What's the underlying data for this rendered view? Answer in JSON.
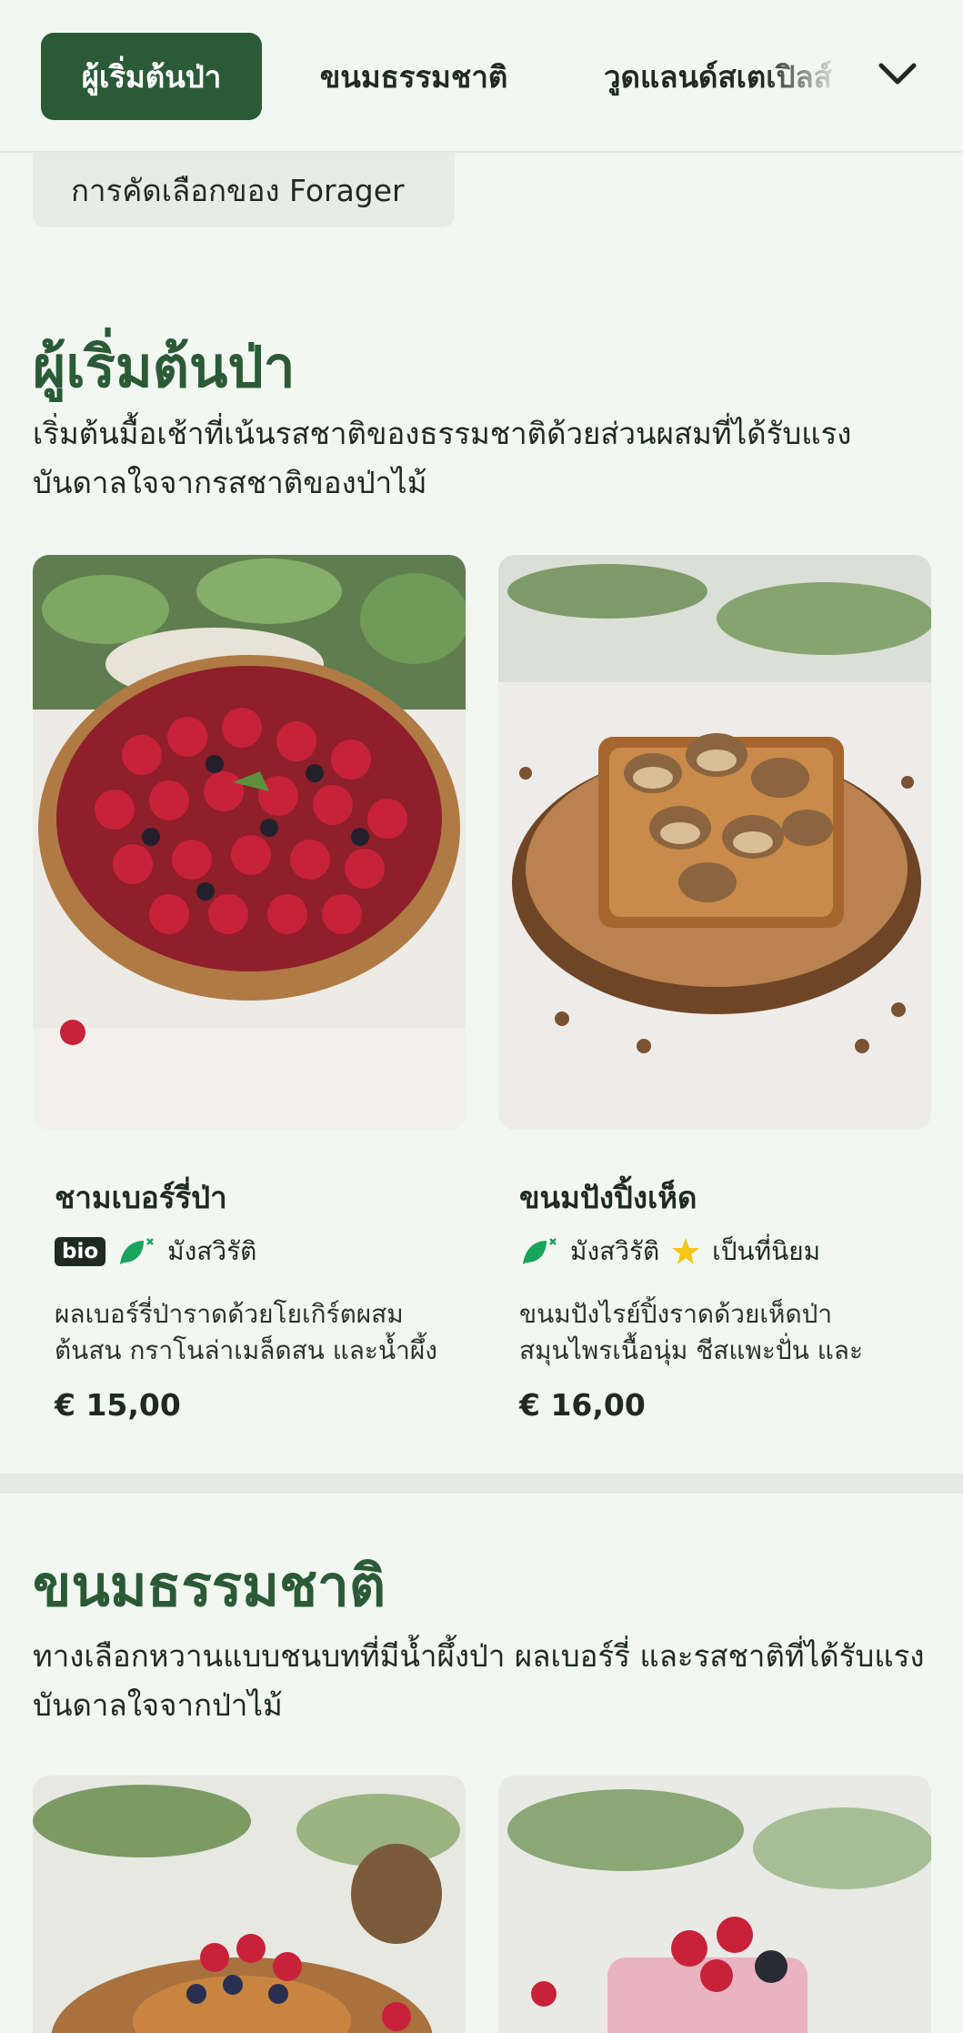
{
  "nav": {
    "tabs": [
      {
        "label": "ผู้เริ่มต้นป่า",
        "active": true
      },
      {
        "label": "ขนมธรรมชาติ",
        "active": false
      },
      {
        "label": "วูดแลนด์สเตเปิลส์",
        "active": false
      }
    ],
    "more_icon": "chevron-down-icon"
  },
  "filter_chip": {
    "label": "การคัดเลือกของ Forager"
  },
  "sections": [
    {
      "title": "ผู้เริ่มต้นป่า",
      "description": "เริ่มต้นมื้อเช้าที่เน้นรสชาติของธรรมชาติด้วยส่วนผสมที่ได้รับแรงบันดาลใจจากรสชาติของป่าไม้",
      "items": [
        {
          "name": "ชามเบอร์รี่ป่า",
          "bio": "bio",
          "diet": "มังสวิรัติ",
          "popular": "",
          "description": "ผลเบอร์รี่ป่าราดด้วยโยเกิร์ตผสมต้นสน กราโนล่าเมล็ดสน และน้ำผึ้ง",
          "price": "€ 15,00"
        },
        {
          "name": "ขนมปังปิ้งเห็ด",
          "bio": "",
          "diet": "มังสวิรัติ",
          "popular": "เป็นที่นิยม",
          "description": "ขนมปังไรย์ปิ้งราดด้วยเห็ดป่าสมุนไพรเนื้อนุ่ม ชีสแพะปั่น และสมุนไพรสด",
          "price": "€ 16,00"
        }
      ]
    },
    {
      "title": "ขนมธรรมชาติ",
      "description": "ทางเลือกหวานแบบชนบทที่มีน้ำผึ้งป่า ผลเบอร์รี่ และรสชาติที่ได้รับแรงบันดาลใจจากป่าไม้"
    }
  ],
  "colors": {
    "accent": "#2b5a37",
    "background": "#f2f7f2",
    "leaf_icon": "#1aa35a",
    "star": "#f5c518"
  }
}
